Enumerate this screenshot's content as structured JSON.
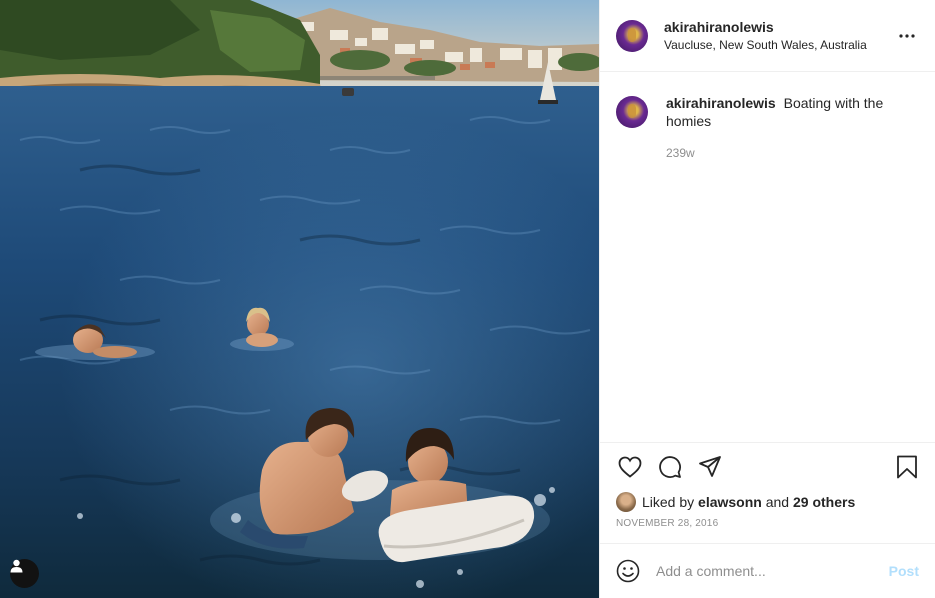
{
  "post": {
    "username": "akirahiranolewis",
    "location": "Vaucluse, New South Wales, Australia",
    "caption": "Boating with the homies",
    "time_ago": "239w",
    "liked_by_prefix": "Liked by",
    "liked_by_user": "elawsonn",
    "liked_by_and": "and",
    "liked_by_others": "29 others",
    "date": "NOVEMBER 28, 2016"
  },
  "comment_box": {
    "placeholder": "Add a comment...",
    "post_label": "Post"
  },
  "icons": {
    "more": "more-options-icon",
    "like": "heart-icon",
    "comment": "comment-icon",
    "share": "send-icon",
    "save": "bookmark-icon",
    "emoji": "emoji-icon",
    "tag": "user-tag-icon"
  },
  "colors": {
    "water": "#1d3f63",
    "post_button": "#b2dffc",
    "secondary_text": "#8e8e8e"
  }
}
